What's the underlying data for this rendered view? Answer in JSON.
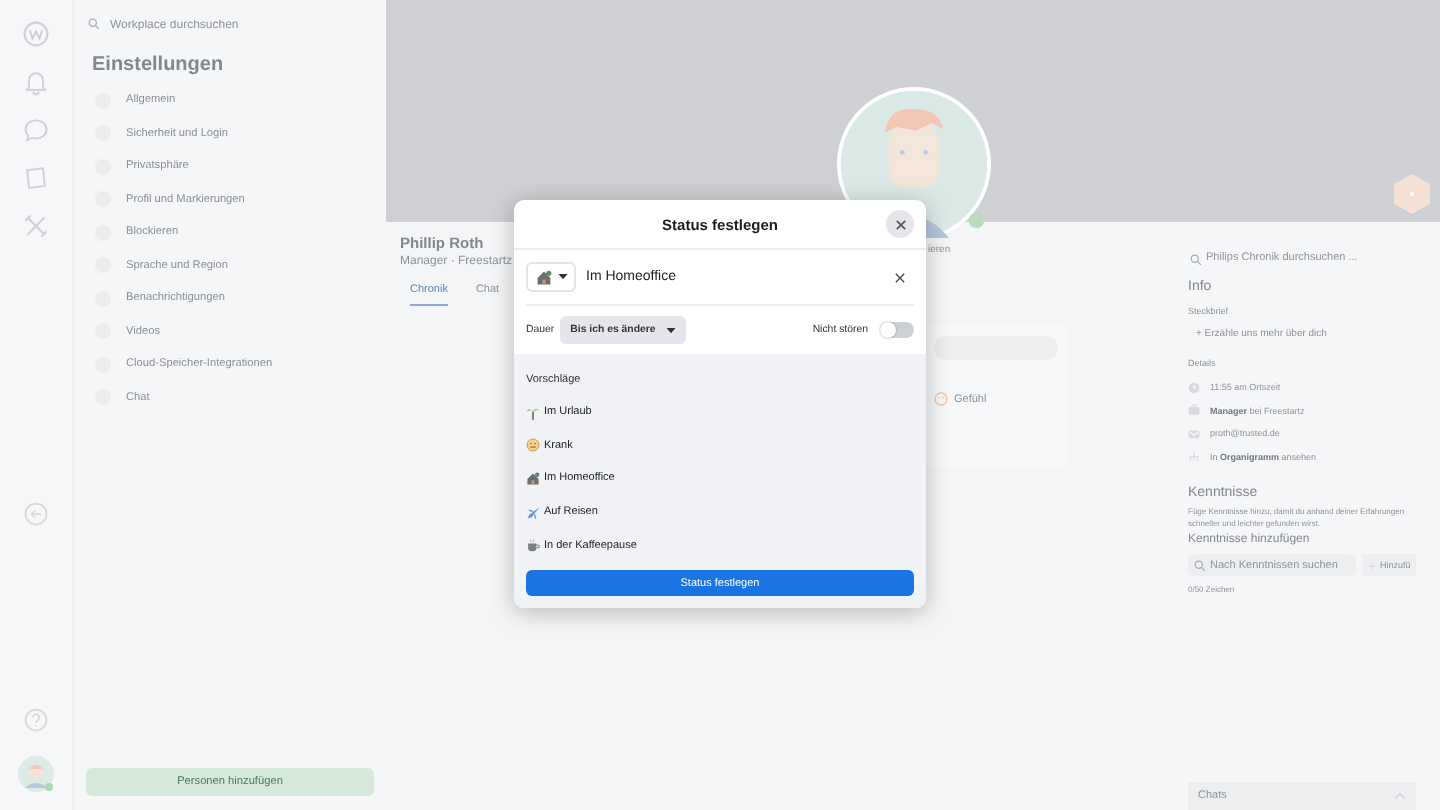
{
  "settings": {
    "search_placeholder": "Workplace durchsuchen",
    "title": "Einstellungen",
    "items": [
      {
        "label": "Allgemein"
      },
      {
        "label": "Sicherheit und Login"
      },
      {
        "label": "Privatsphäre"
      },
      {
        "label": "Profil und Markierungen"
      },
      {
        "label": "Blockieren"
      },
      {
        "label": "Sprache und Region"
      },
      {
        "label": "Benachrichtigungen"
      },
      {
        "label": "Videos"
      },
      {
        "label": "Cloud-Speicher-Integrationen"
      },
      {
        "label": "Chat"
      }
    ],
    "add_button": "Personen hinzufügen"
  },
  "profile": {
    "name": "Phillip Roth",
    "subtitle": "Manager · Freestartz",
    "avatar_caption": "ieren",
    "tabs": [
      {
        "label": "Chronik",
        "selected": true
      },
      {
        "label": "Chat",
        "selected": false
      }
    ]
  },
  "mood_card": {
    "option": "Gefühl"
  },
  "sidebar": {
    "search_placeholder": "Philips Chronik durchsuchen ...",
    "info_title": "Info",
    "profile_label": "Steckbrief",
    "add_about": "+ Erzähle uns mehr über dich",
    "details_label": "Details",
    "details": [
      {
        "kind": "clock",
        "text": "11:55 am Ortszeit"
      },
      {
        "kind": "job",
        "text": "**Manager** bei Freestartz"
      },
      {
        "kind": "mail",
        "text": "proth@trusted.de"
      },
      {
        "kind": "org",
        "text": "In **Organigramm** ansehen"
      }
    ],
    "skills_title": "Kenntnisse",
    "skills_hint": "Füge Kenntnisse hinzu, damit du anhand deiner Erfahrungen schneller und leichter gefunden wirst.",
    "skills_add_label": "Kenntnisse hinzufügen",
    "skills_search_placeholder": "Nach Kenntnissen suchen",
    "skills_add_button": "Hinzufü",
    "char_count": "0/50 Zeichen"
  },
  "chats_bar": {
    "label": "Chats"
  },
  "dialog": {
    "title": "Status festlegen",
    "status_value": "Im Homeoffice",
    "duration_label": "Dauer",
    "duration_value": "Bis ich es ändere",
    "dnd_label": "Nicht stören",
    "dnd_on": false,
    "suggestions_title": "Vorschläge",
    "suggestions": [
      {
        "kind": "palm",
        "label": "Im Urlaub"
      },
      {
        "kind": "sick",
        "label": "Krank"
      },
      {
        "kind": "house",
        "label": "Im Homeoffice"
      },
      {
        "kind": "plane",
        "label": "Auf Reisen"
      },
      {
        "kind": "coffee",
        "label": "In der Kaffeepause"
      }
    ],
    "submit": "Status festlegen"
  }
}
